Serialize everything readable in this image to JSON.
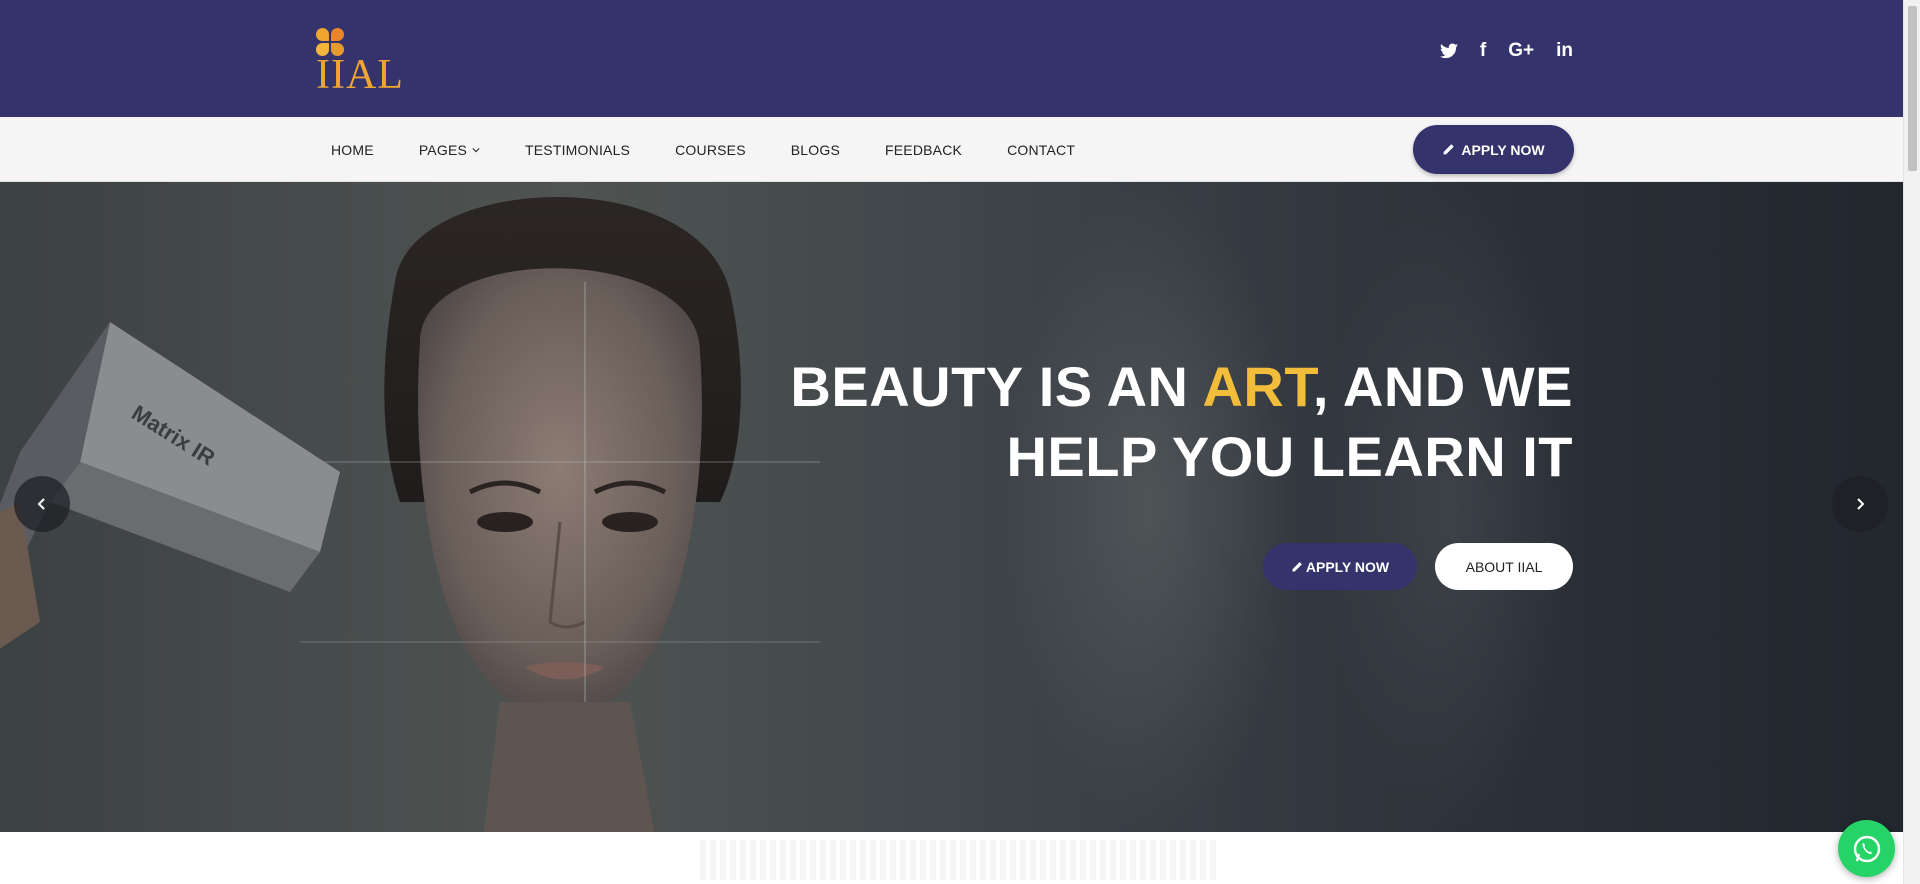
{
  "brand": {
    "name": "IIAL",
    "accent": "#f0a531",
    "primary": "#34336b",
    "highlight": "#f3bd3c"
  },
  "social": [
    {
      "name": "twitter",
      "icon": "twitter-icon"
    },
    {
      "name": "facebook",
      "icon": "facebook-icon",
      "glyph": "f"
    },
    {
      "name": "google-plus",
      "icon": "google-plus-icon",
      "glyph": "G+"
    },
    {
      "name": "linkedin",
      "icon": "linkedin-icon",
      "glyph": "in"
    }
  ],
  "nav": {
    "items": [
      {
        "label": "HOME"
      },
      {
        "label": "PAGES",
        "icon": "chevron-down-icon"
      },
      {
        "label": "TESTIMONIALS"
      },
      {
        "label": "COURSES"
      },
      {
        "label": "BLOGS"
      },
      {
        "label": "FEEDBACK"
      },
      {
        "label": "CONTACT"
      }
    ],
    "apply_label": "APPLY NOW"
  },
  "hero": {
    "headline_part1": "BEAUTY IS AN ",
    "headline_highlight": "ART",
    "headline_part2": ", AND WE",
    "headline_line2": "HELP YOU LEARN IT",
    "apply_label": "APPLY NOW",
    "about_label": "ABOUT IIAL",
    "device_label": "Matrix IR"
  }
}
